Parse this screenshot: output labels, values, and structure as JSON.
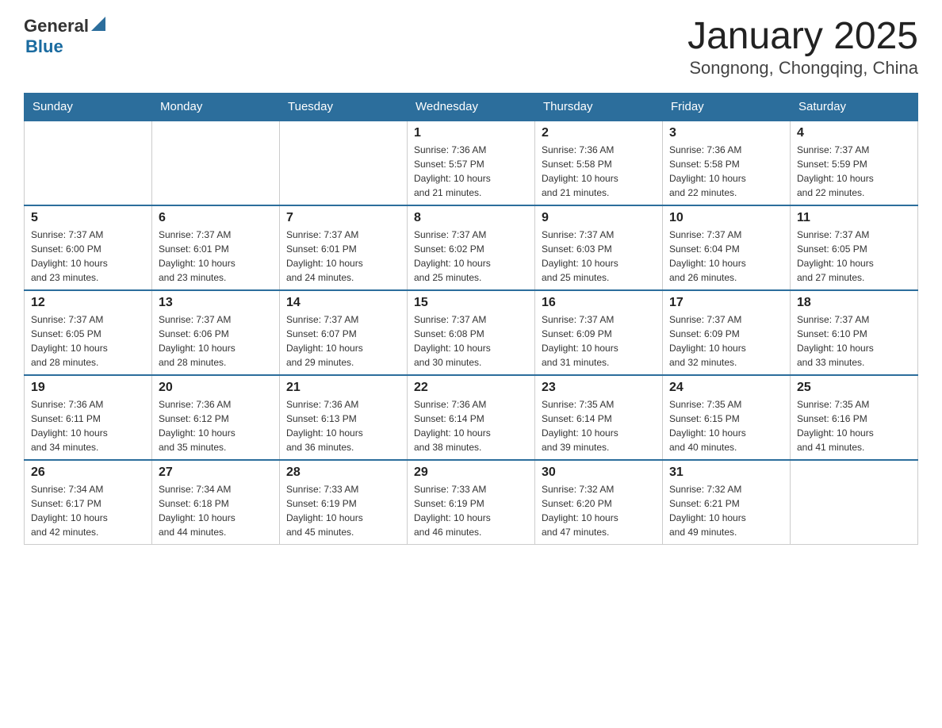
{
  "header": {
    "title": "January 2025",
    "subtitle": "Songnong, Chongqing, China",
    "logo_general": "General",
    "logo_blue": "Blue"
  },
  "weekdays": [
    "Sunday",
    "Monday",
    "Tuesday",
    "Wednesday",
    "Thursday",
    "Friday",
    "Saturday"
  ],
  "weeks": [
    [
      {
        "day": "",
        "info": ""
      },
      {
        "day": "",
        "info": ""
      },
      {
        "day": "",
        "info": ""
      },
      {
        "day": "1",
        "info": "Sunrise: 7:36 AM\nSunset: 5:57 PM\nDaylight: 10 hours\nand 21 minutes."
      },
      {
        "day": "2",
        "info": "Sunrise: 7:36 AM\nSunset: 5:58 PM\nDaylight: 10 hours\nand 21 minutes."
      },
      {
        "day": "3",
        "info": "Sunrise: 7:36 AM\nSunset: 5:58 PM\nDaylight: 10 hours\nand 22 minutes."
      },
      {
        "day": "4",
        "info": "Sunrise: 7:37 AM\nSunset: 5:59 PM\nDaylight: 10 hours\nand 22 minutes."
      }
    ],
    [
      {
        "day": "5",
        "info": "Sunrise: 7:37 AM\nSunset: 6:00 PM\nDaylight: 10 hours\nand 23 minutes."
      },
      {
        "day": "6",
        "info": "Sunrise: 7:37 AM\nSunset: 6:01 PM\nDaylight: 10 hours\nand 23 minutes."
      },
      {
        "day": "7",
        "info": "Sunrise: 7:37 AM\nSunset: 6:01 PM\nDaylight: 10 hours\nand 24 minutes."
      },
      {
        "day": "8",
        "info": "Sunrise: 7:37 AM\nSunset: 6:02 PM\nDaylight: 10 hours\nand 25 minutes."
      },
      {
        "day": "9",
        "info": "Sunrise: 7:37 AM\nSunset: 6:03 PM\nDaylight: 10 hours\nand 25 minutes."
      },
      {
        "day": "10",
        "info": "Sunrise: 7:37 AM\nSunset: 6:04 PM\nDaylight: 10 hours\nand 26 minutes."
      },
      {
        "day": "11",
        "info": "Sunrise: 7:37 AM\nSunset: 6:05 PM\nDaylight: 10 hours\nand 27 minutes."
      }
    ],
    [
      {
        "day": "12",
        "info": "Sunrise: 7:37 AM\nSunset: 6:05 PM\nDaylight: 10 hours\nand 28 minutes."
      },
      {
        "day": "13",
        "info": "Sunrise: 7:37 AM\nSunset: 6:06 PM\nDaylight: 10 hours\nand 28 minutes."
      },
      {
        "day": "14",
        "info": "Sunrise: 7:37 AM\nSunset: 6:07 PM\nDaylight: 10 hours\nand 29 minutes."
      },
      {
        "day": "15",
        "info": "Sunrise: 7:37 AM\nSunset: 6:08 PM\nDaylight: 10 hours\nand 30 minutes."
      },
      {
        "day": "16",
        "info": "Sunrise: 7:37 AM\nSunset: 6:09 PM\nDaylight: 10 hours\nand 31 minutes."
      },
      {
        "day": "17",
        "info": "Sunrise: 7:37 AM\nSunset: 6:09 PM\nDaylight: 10 hours\nand 32 minutes."
      },
      {
        "day": "18",
        "info": "Sunrise: 7:37 AM\nSunset: 6:10 PM\nDaylight: 10 hours\nand 33 minutes."
      }
    ],
    [
      {
        "day": "19",
        "info": "Sunrise: 7:36 AM\nSunset: 6:11 PM\nDaylight: 10 hours\nand 34 minutes."
      },
      {
        "day": "20",
        "info": "Sunrise: 7:36 AM\nSunset: 6:12 PM\nDaylight: 10 hours\nand 35 minutes."
      },
      {
        "day": "21",
        "info": "Sunrise: 7:36 AM\nSunset: 6:13 PM\nDaylight: 10 hours\nand 36 minutes."
      },
      {
        "day": "22",
        "info": "Sunrise: 7:36 AM\nSunset: 6:14 PM\nDaylight: 10 hours\nand 38 minutes."
      },
      {
        "day": "23",
        "info": "Sunrise: 7:35 AM\nSunset: 6:14 PM\nDaylight: 10 hours\nand 39 minutes."
      },
      {
        "day": "24",
        "info": "Sunrise: 7:35 AM\nSunset: 6:15 PM\nDaylight: 10 hours\nand 40 minutes."
      },
      {
        "day": "25",
        "info": "Sunrise: 7:35 AM\nSunset: 6:16 PM\nDaylight: 10 hours\nand 41 minutes."
      }
    ],
    [
      {
        "day": "26",
        "info": "Sunrise: 7:34 AM\nSunset: 6:17 PM\nDaylight: 10 hours\nand 42 minutes."
      },
      {
        "day": "27",
        "info": "Sunrise: 7:34 AM\nSunset: 6:18 PM\nDaylight: 10 hours\nand 44 minutes."
      },
      {
        "day": "28",
        "info": "Sunrise: 7:33 AM\nSunset: 6:19 PM\nDaylight: 10 hours\nand 45 minutes."
      },
      {
        "day": "29",
        "info": "Sunrise: 7:33 AM\nSunset: 6:19 PM\nDaylight: 10 hours\nand 46 minutes."
      },
      {
        "day": "30",
        "info": "Sunrise: 7:32 AM\nSunset: 6:20 PM\nDaylight: 10 hours\nand 47 minutes."
      },
      {
        "day": "31",
        "info": "Sunrise: 7:32 AM\nSunset: 6:21 PM\nDaylight: 10 hours\nand 49 minutes."
      },
      {
        "day": "",
        "info": ""
      }
    ]
  ]
}
